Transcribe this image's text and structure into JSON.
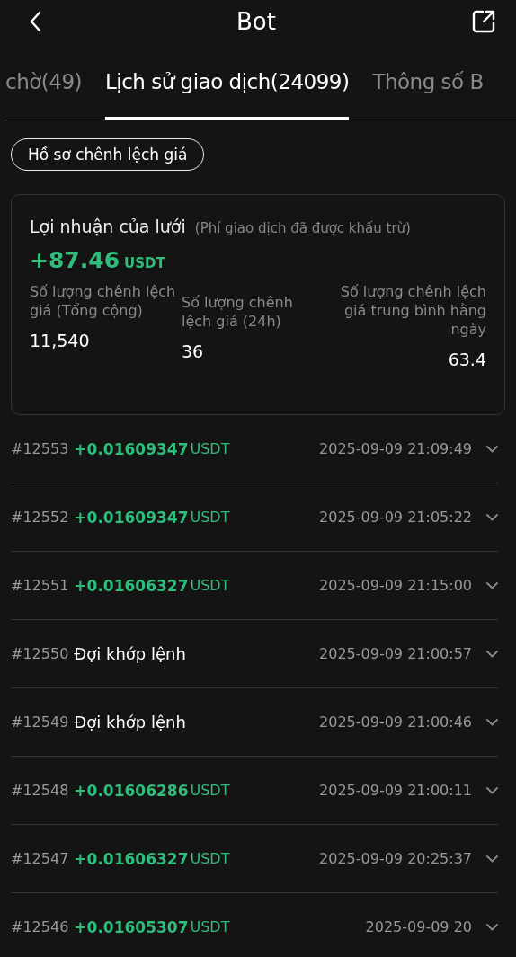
{
  "header": {
    "title": "Bot"
  },
  "tabs": [
    {
      "label": "chờ(49)",
      "selected": false
    },
    {
      "label": "Lịch sử giao dịch(24099)",
      "selected": true
    },
    {
      "label": "Thông số B",
      "selected": false
    }
  ],
  "filter_chip": "Hồ sơ chênh lệch giá",
  "summary": {
    "title": "Lợi nhuận của lưới",
    "note": "(Phí giao dịch đã được khấu trừ)",
    "profit": "+87.46",
    "profit_unit": "USDT",
    "stats": [
      {
        "label": "Số lượng chênh lệch giá (Tổng cộng)",
        "value": "11,540"
      },
      {
        "label": "Số lượng chênh lệch giá (24h)",
        "value": "36"
      },
      {
        "label": "Số lượng chênh lệch giá trung bình hằng ngày",
        "value": "63.4"
      }
    ]
  },
  "trades": [
    {
      "id": "#12553",
      "kind": "profit",
      "amount": "+0.01609347",
      "unit": "USDT",
      "time": "2025-09-09 21:09:49"
    },
    {
      "id": "#12552",
      "kind": "profit",
      "amount": "+0.01609347",
      "unit": "USDT",
      "time": "2025-09-09 21:05:22"
    },
    {
      "id": "#12551",
      "kind": "profit",
      "amount": "+0.01606327",
      "unit": "USDT",
      "time": "2025-09-09 21:15:00"
    },
    {
      "id": "#12550",
      "kind": "pending",
      "status": "Đợi khớp lệnh",
      "time": "2025-09-09 21:00:57"
    },
    {
      "id": "#12549",
      "kind": "pending",
      "status": "Đợi khớp lệnh",
      "time": "2025-09-09 21:00:46"
    },
    {
      "id": "#12548",
      "kind": "profit",
      "amount": "+0.01606286",
      "unit": "USDT",
      "time": "2025-09-09 21:00:11"
    },
    {
      "id": "#12547",
      "kind": "profit",
      "amount": "+0.01606327",
      "unit": "USDT",
      "time": "2025-09-09 20:25:37"
    },
    {
      "id": "#12546",
      "kind": "profit",
      "amount": "+0.01605307",
      "unit": "USDT",
      "time": "2025-09-09 20"
    }
  ]
}
